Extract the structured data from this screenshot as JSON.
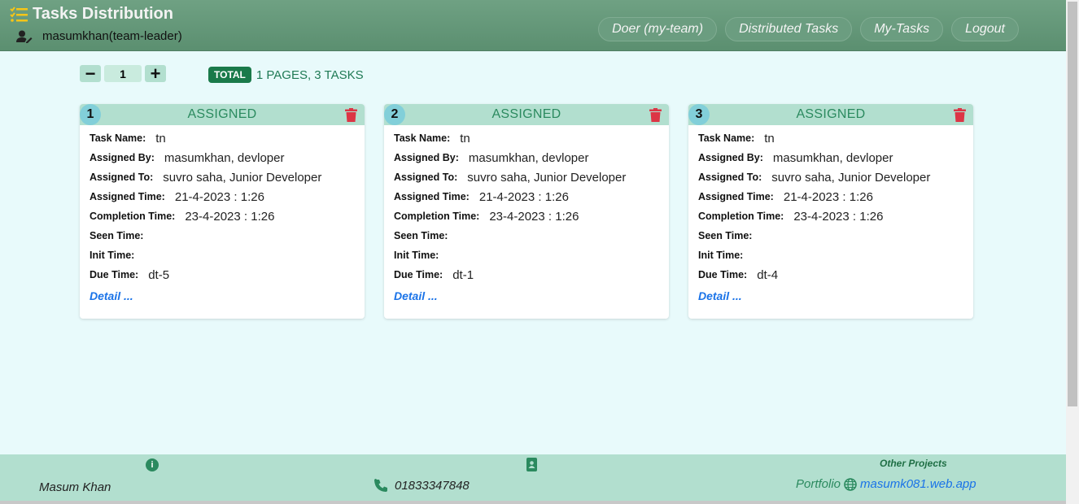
{
  "header": {
    "title": "Tasks Distribution",
    "user": "masumkhan(team-leader)",
    "nav": [
      "Doer (my-team)",
      "Distributed Tasks",
      "My-Tasks",
      "Logout"
    ]
  },
  "pager": {
    "minus": "−",
    "page": "1",
    "plus": "+",
    "total_badge": "TOTAL",
    "total_text": "1 PAGES, 3 TASKS"
  },
  "labels": {
    "task_name": "Task Name:",
    "assigned_by": "Assigned By:",
    "assigned_to": "Assigned To:",
    "assigned_time": "Assigned Time:",
    "completion_time": "Completion Time:",
    "seen_time": "Seen Time:",
    "init_time": "Init Time:",
    "due_time": "Due Time:",
    "detail": "Detail ..."
  },
  "cards": [
    {
      "num": "1",
      "status": "ASSIGNED",
      "task_name": "tn",
      "assigned_by": "masumkhan, devloper",
      "assigned_to": "suvro saha, Junior Developer",
      "assigned_time": "21-4-2023 : 1:26",
      "completion_time": "23-4-2023 : 1:26",
      "seen_time": "",
      "init_time": "",
      "due_time": "dt-5"
    },
    {
      "num": "2",
      "status": "ASSIGNED",
      "task_name": "tn",
      "assigned_by": "masumkhan, devloper",
      "assigned_to": "suvro saha, Junior Developer",
      "assigned_time": "21-4-2023 : 1:26",
      "completion_time": "23-4-2023 : 1:26",
      "seen_time": "",
      "init_time": "",
      "due_time": "dt-1"
    },
    {
      "num": "3",
      "status": "ASSIGNED",
      "task_name": "tn",
      "assigned_by": "masumkhan, devloper",
      "assigned_to": "suvro saha, Junior Developer",
      "assigned_time": "21-4-2023 : 1:26",
      "completion_time": "23-4-2023 : 1:26",
      "seen_time": "",
      "init_time": "",
      "due_time": "dt-4"
    }
  ],
  "footer": {
    "name": "Masum Khan",
    "phone": "01833347848",
    "other_projects": "Other Projects",
    "portfolio_label": "Portfolio",
    "portfolio_link": "masumk081.web.app"
  },
  "colors": {
    "header": "#5b8f70",
    "accent": "#b2dfcf",
    "status_text": "#2b8a5f",
    "delete": "#dc3545",
    "link": "#1a73e8",
    "brand_icon": "#f5c518"
  }
}
